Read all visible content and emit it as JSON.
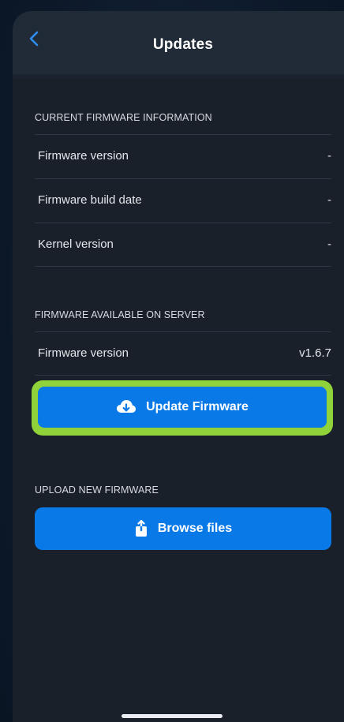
{
  "header": {
    "title": "Updates",
    "back_icon": "chevron-left-icon"
  },
  "current_firmware": {
    "section_title": "CURRENT FIRMWARE INFORMATION",
    "rows": [
      {
        "label": "Firmware version",
        "value": "-"
      },
      {
        "label": "Firmware build date",
        "value": "-"
      },
      {
        "label": "Kernel version",
        "value": "-"
      }
    ]
  },
  "server_firmware": {
    "section_title": "FIRMWARE AVAILABLE ON SERVER",
    "rows": [
      {
        "label": "Firmware version",
        "value": "v1.6.7"
      }
    ],
    "update_button": {
      "label": "Update Firmware",
      "icon": "cloud-download-icon"
    }
  },
  "upload_firmware": {
    "section_title": "UPLOAD NEW FIRMWARE",
    "browse_button": {
      "label": "Browse files",
      "icon": "share-upload-icon"
    }
  },
  "colors": {
    "accent": "#0a79e8",
    "highlight": "#8fd23a",
    "background": "#1a2029",
    "header": "#212a37",
    "back_chevron": "#2f8cf0"
  }
}
